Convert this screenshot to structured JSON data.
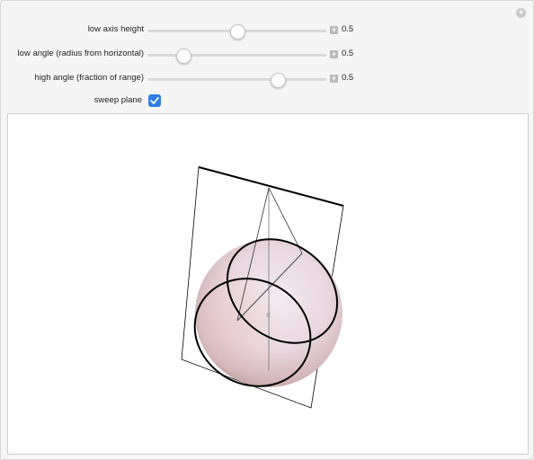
{
  "controls": {
    "sliders": [
      {
        "label": "low axis height",
        "value": "0.5",
        "fraction": 0.5
      },
      {
        "label": "low angle (radius from horizontal)",
        "value": "0.5",
        "fraction": 0.2
      },
      {
        "label": "high angle (fraction of range)",
        "value": "0.5",
        "fraction": 0.73
      }
    ],
    "sweep_plane": {
      "label": "sweep plane",
      "checked": true
    }
  },
  "icons": {
    "corner": "plus-circle-icon",
    "stepper": "plus-square-icon",
    "check": "checkmark-icon"
  },
  "colors": {
    "accent": "#2f7fe6",
    "sphere_light": "#f0e6ec",
    "sphere_dark": "#c8a9a9"
  }
}
